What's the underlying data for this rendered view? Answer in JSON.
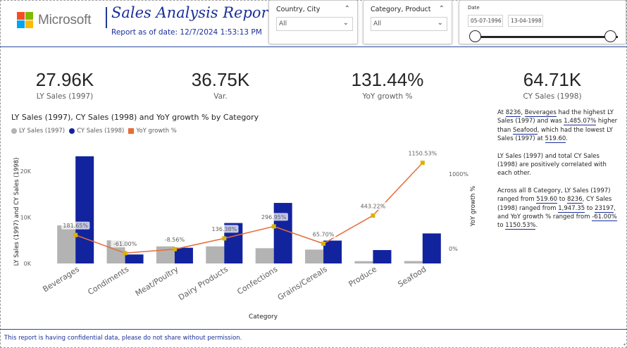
{
  "header": {
    "logo_text": "Microsoft",
    "logo_colors": [
      "#f25022",
      "#7fba00",
      "#00a4ef",
      "#ffb900"
    ],
    "title": "Sales Analysis Report",
    "date_text": "Report as of date: 12/7/2024 1:53:13 PM"
  },
  "slicers": {
    "country_city": {
      "title": "Country, City",
      "value": "All"
    },
    "category_product": {
      "title": "Category, Product",
      "value": "All"
    },
    "date": {
      "title": "Date",
      "start": "05-07-1996",
      "end": "13-04-1998"
    }
  },
  "kpis": [
    {
      "value": "27.96K",
      "label": "LY Sales (1997)"
    },
    {
      "value": "36.75K",
      "label": "Var."
    },
    {
      "value": "131.44%",
      "label": "YoY growth %"
    },
    {
      "value": "64.71K",
      "label": "CY Sales (1998)"
    }
  ],
  "chart_data": {
    "type": "bar",
    "title": "LY Sales (1997), CY Sales (1998) and YoY growth % by Category",
    "xlabel": "Category",
    "ylabel": "LY Sales (1997) and CY Sales (1998)",
    "y2label": "YoY growth %",
    "legend_position": "top-left",
    "categories": [
      "Beverages",
      "Condiments",
      "Meat/Poultry",
      "Dairy Products",
      "Confections",
      "Grains/Cereals",
      "Produce",
      "Seafood"
    ],
    "series": [
      {
        "name": "LY Sales (1997)",
        "type": "bar",
        "color": "#b3b3b3",
        "values": [
          8236,
          5000,
          3700,
          3700,
          3300,
          3000,
          500,
          519.6
        ]
      },
      {
        "name": "CY Sales (1998)",
        "type": "bar",
        "color": "#12239e",
        "values": [
          23197,
          1947.35,
          3400,
          8750,
          13100,
          4950,
          2900,
          6500
        ]
      },
      {
        "name": "YoY growth %",
        "type": "line",
        "axis": "right",
        "color": "#e66c37",
        "values": [
          181.65,
          -61.0,
          -8.56,
          136.38,
          296.95,
          65.7,
          443.22,
          1150.53
        ],
        "labels": [
          "181.65%",
          "-61.00%",
          "-8.56%",
          "136.38%",
          "296.95%",
          "65.70%",
          "443.22%",
          "1150.53%"
        ]
      }
    ],
    "y_ticks": [
      "0K",
      "10K",
      "20K"
    ],
    "y_tick_values": [
      0,
      10000,
      20000
    ],
    "ylim": [
      0,
      25000
    ],
    "y2_ticks": [
      "0%",
      "1000%"
    ],
    "y2_tick_values": [
      0,
      1000
    ],
    "y2lim": [
      -200,
      1350
    ],
    "grid": false
  },
  "narrative": {
    "p1": {
      "t1": "At ",
      "v1": "8236",
      "t2": ", ",
      "v2": "Beverages",
      "t3": " had the highest LY Sales (1997) and was ",
      "v3": "1,485.07%",
      "t4": " higher than ",
      "v4": "Seafood",
      "t5": ", which had the lowest LY Sales (1997) at ",
      "v5": "519.60",
      "t6": "."
    },
    "p2": "LY Sales (1997) and total CY Sales (1998) are positively correlated with each other.",
    "p3": {
      "t1": "Across all 8 Category, LY Sales (1997) ranged from ",
      "v1": "519.60",
      "t2": " to ",
      "v2": "8236",
      "t3": ", CY Sales (1998) ranged from ",
      "v3": "1,947.35",
      "t4": " to ",
      "v4": "23197",
      "t5": ", and YoY growth % ranged from ",
      "v5": "-61.00%",
      "t6": " to ",
      "v6": "1150.53%",
      "t7": "."
    }
  },
  "footer": {
    "text": "This report is having confidential data, please do not share without permission."
  }
}
